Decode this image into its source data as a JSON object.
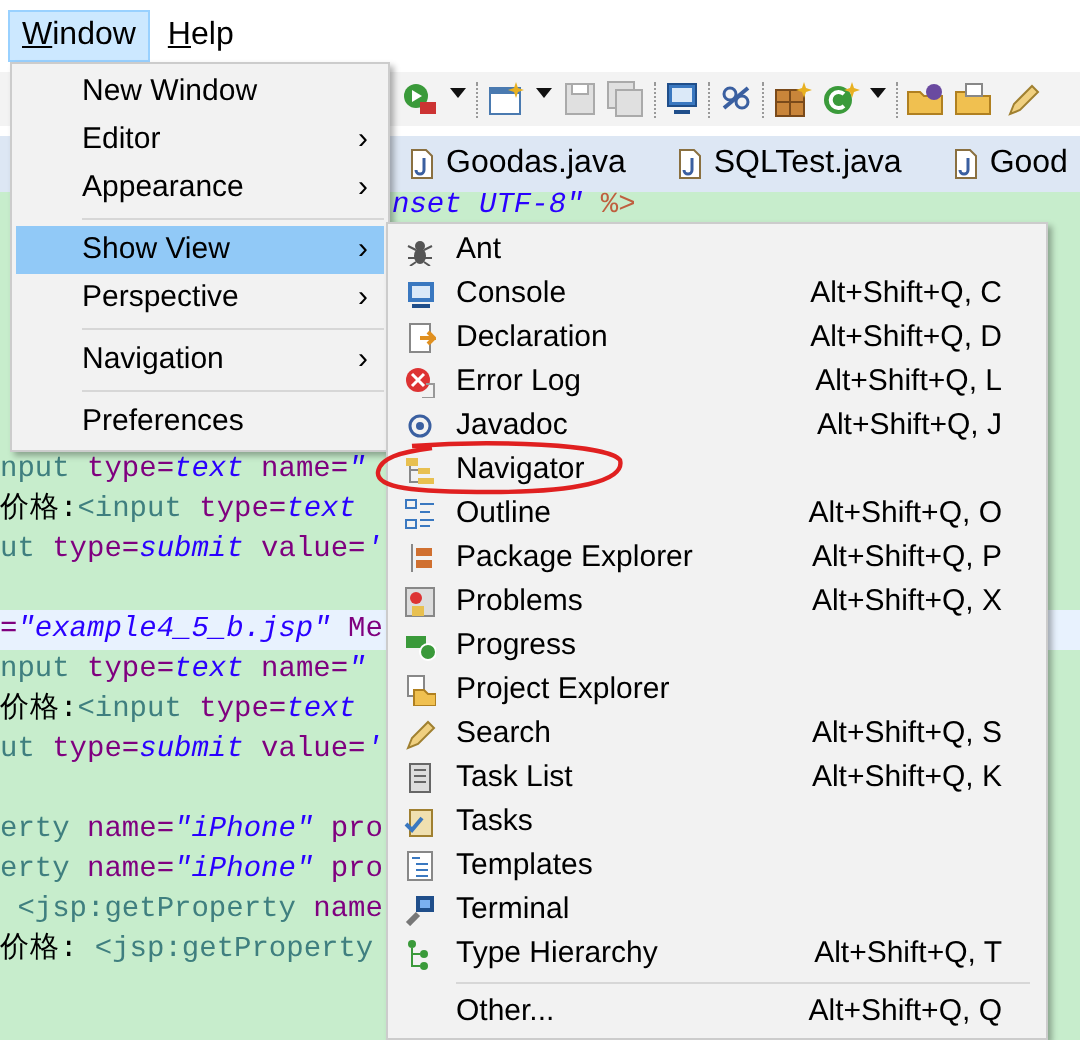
{
  "menubar": [
    {
      "key": "W",
      "rest": "indow",
      "selected": true
    },
    {
      "key": "H",
      "rest": "elp",
      "selected": false
    }
  ],
  "window_menu": [
    {
      "kind": "item",
      "label": "New Window",
      "submenu": false,
      "selected": false
    },
    {
      "kind": "item",
      "label": "Editor",
      "submenu": true,
      "selected": false
    },
    {
      "kind": "item",
      "label": "Appearance",
      "submenu": true,
      "selected": false
    },
    {
      "kind": "separator"
    },
    {
      "kind": "item",
      "label": "Show View",
      "submenu": true,
      "selected": true
    },
    {
      "kind": "item",
      "label": "Perspective",
      "submenu": true,
      "selected": false
    },
    {
      "kind": "separator"
    },
    {
      "kind": "item",
      "label": "Navigation",
      "submenu": true,
      "selected": false
    },
    {
      "kind": "separator"
    },
    {
      "kind": "item",
      "label": "Preferences",
      "submenu": false,
      "selected": false
    }
  ],
  "submenu_arrow": "›",
  "show_view_menu": [
    {
      "kind": "item",
      "label": "Ant",
      "circled": false
    },
    {
      "kind": "item",
      "label": "Console",
      "shortcut": "Alt+Shift+Q, C",
      "circled": false
    },
    {
      "kind": "item",
      "label": "Declaration",
      "shortcut": "Alt+Shift+Q, D",
      "circled": false
    },
    {
      "kind": "item",
      "label": "Error Log",
      "shortcut": "Alt+Shift+Q, L",
      "circled": false
    },
    {
      "kind": "item",
      "label": "Javadoc",
      "shortcut": "Alt+Shift+Q, J",
      "circled": false
    },
    {
      "kind": "item",
      "label": "Navigator",
      "circled": true
    },
    {
      "kind": "item",
      "label": "Outline",
      "shortcut": "Alt+Shift+Q, O",
      "circled": false
    },
    {
      "kind": "item",
      "label": "Package Explorer",
      "shortcut": "Alt+Shift+Q, P",
      "circled": false
    },
    {
      "kind": "item",
      "label": "Problems",
      "shortcut": "Alt+Shift+Q, X",
      "circled": false
    },
    {
      "kind": "item",
      "label": "Progress",
      "circled": false
    },
    {
      "kind": "item",
      "label": "Project Explorer",
      "circled": false
    },
    {
      "kind": "item",
      "label": "Search",
      "shortcut": "Alt+Shift+Q, S",
      "circled": false
    },
    {
      "kind": "item",
      "label": "Task List",
      "shortcut": "Alt+Shift+Q, K",
      "circled": false
    },
    {
      "kind": "item",
      "label": "Tasks",
      "circled": false
    },
    {
      "kind": "item",
      "label": "Templates",
      "circled": false
    },
    {
      "kind": "item",
      "label": "Terminal",
      "circled": false
    },
    {
      "kind": "item",
      "label": "Type Hierarchy",
      "shortcut": "Alt+Shift+Q, T",
      "circled": false
    },
    {
      "kind": "separator"
    },
    {
      "kind": "item",
      "label": "Other...",
      "shortcut": "Alt+Shift+Q, Q",
      "circled": false
    }
  ],
  "editor_tabs": [
    {
      "label": "Goodas.java"
    },
    {
      "label": "SQLTest.java"
    },
    {
      "label": "Good"
    }
  ],
  "code_lines": [
    {
      "highlighted": false,
      "covered_start": true,
      "segments": [
        {
          "kind": "value",
          "text": "nset UTF-8\""
        },
        {
          "kind": "directive",
          "text": " %>"
        }
      ]
    },
    {
      "highlighted": false
    },
    {
      "highlighted": false
    },
    {
      "highlighted": false
    },
    {
      "highlighted": false
    },
    {
      "highlighted": false
    },
    {
      "highlighted": false,
      "segments": [
        {
          "kind": "tag",
          "text": "nput "
        },
        {
          "kind": "attr",
          "text": "type="
        },
        {
          "kind": "value",
          "text": "text"
        },
        {
          "kind": "attr",
          "text": " name="
        },
        {
          "kind": "value",
          "text": "\""
        }
      ]
    },
    {
      "highlighted": false,
      "segments": [
        {
          "kind": "text",
          "text": "价格:"
        },
        {
          "kind": "tag",
          "text": "<input "
        },
        {
          "kind": "attr",
          "text": "type="
        },
        {
          "kind": "value",
          "text": "text"
        }
      ]
    },
    {
      "highlighted": false,
      "segments": [
        {
          "kind": "tag",
          "text": "ut "
        },
        {
          "kind": "attr",
          "text": "type="
        },
        {
          "kind": "value",
          "text": "submit"
        },
        {
          "kind": "attr",
          "text": " value="
        },
        {
          "kind": "value",
          "text": "'"
        }
      ]
    },
    {
      "highlighted": false
    },
    {
      "highlighted": true,
      "segments": [
        {
          "kind": "attr",
          "text": "="
        },
        {
          "kind": "value",
          "text": "\"example4_5_b.jsp\""
        },
        {
          "kind": "attr",
          "text": " Me"
        }
      ]
    },
    {
      "highlighted": false,
      "segments": [
        {
          "kind": "tag",
          "text": "nput "
        },
        {
          "kind": "attr",
          "text": "type="
        },
        {
          "kind": "value",
          "text": "text"
        },
        {
          "kind": "attr",
          "text": " name="
        },
        {
          "kind": "value",
          "text": "\""
        }
      ]
    },
    {
      "highlighted": false,
      "segments": [
        {
          "kind": "text",
          "text": "价格:"
        },
        {
          "kind": "tag",
          "text": "<input "
        },
        {
          "kind": "attr",
          "text": "type="
        },
        {
          "kind": "value",
          "text": "text"
        }
      ]
    },
    {
      "highlighted": false,
      "segments": [
        {
          "kind": "tag",
          "text": "ut "
        },
        {
          "kind": "attr",
          "text": "type="
        },
        {
          "kind": "value",
          "text": "submit"
        },
        {
          "kind": "attr",
          "text": " value="
        },
        {
          "kind": "value",
          "text": "'"
        }
      ]
    },
    {
      "highlighted": false
    },
    {
      "highlighted": false,
      "segments": [
        {
          "kind": "tag",
          "text": "erty "
        },
        {
          "kind": "attr",
          "text": "name="
        },
        {
          "kind": "value",
          "text": "\"iPhone\""
        },
        {
          "kind": "attr",
          "text": " pro"
        }
      ]
    },
    {
      "highlighted": false,
      "segments": [
        {
          "kind": "tag",
          "text": "erty "
        },
        {
          "kind": "attr",
          "text": "name="
        },
        {
          "kind": "value",
          "text": "\"iPhone\""
        },
        {
          "kind": "attr",
          "text": " pro"
        }
      ]
    },
    {
      "highlighted": false,
      "segments": [
        {
          "kind": "tag",
          "text": " <jsp:getProperty "
        },
        {
          "kind": "attr",
          "text": "name"
        }
      ]
    },
    {
      "highlighted": false,
      "segments": [
        {
          "kind": "text",
          "text": "价格: "
        },
        {
          "kind": "tag",
          "text": "<jsp:getProperty"
        }
      ]
    }
  ]
}
